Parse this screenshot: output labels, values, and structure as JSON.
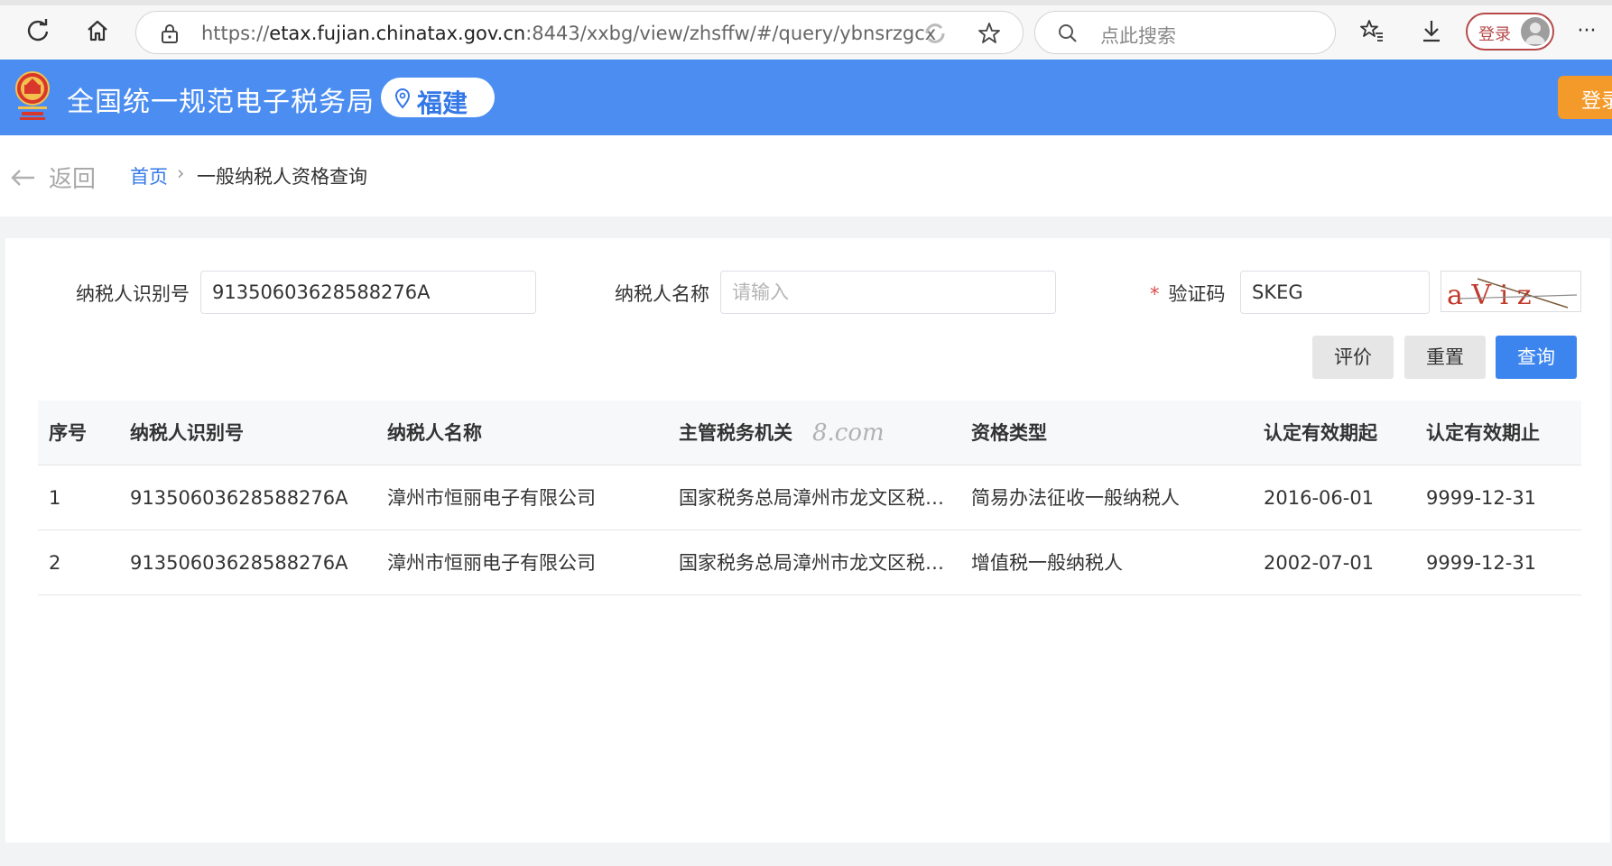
{
  "browser": {
    "url_prefix": "https://",
    "url_host": "etax.fujian.chinatax.gov.cn",
    "url_rest": ":8443/xxbg/view/zhsffw/#/query/ybnsrzgcx",
    "search_placeholder": "点此搜索",
    "login_label": "登录",
    "more_label": "···"
  },
  "header": {
    "site_title": "全国统一规范电子税务局",
    "region": "福建",
    "login_label": "登录"
  },
  "breadcrumb": {
    "back_label": "返回",
    "home": "首页",
    "separator": "›",
    "current": "一般纳税人资格查询"
  },
  "form": {
    "taxpayer_id_label": "纳税人识别号",
    "taxpayer_id_value": "91350603628588276A",
    "taxpayer_name_label": "纳税人名称",
    "taxpayer_name_placeholder": "请输入",
    "captcha_required_mark": "*",
    "captcha_label": "验证码",
    "captcha_value": "SKEG",
    "captcha_image_text": "a V i z",
    "evaluate_label": "评价",
    "reset_label": "重置",
    "query_label": "查询"
  },
  "table": {
    "headers": [
      "序号",
      "纳税人识别号",
      "纳税人名称",
      "主管税务机关",
      "资格类型",
      "认定有效期起",
      "认定有效期止"
    ],
    "watermark": "8.com",
    "rows": [
      [
        "1",
        "91350603628588276A",
        "漳州市恒丽电子有限公司",
        "国家税务总局漳州市龙文区税…",
        "简易办法征收一般纳税人",
        "2016-06-01",
        "9999-12-31"
      ],
      [
        "2",
        "91350603628588276A",
        "漳州市恒丽电子有限公司",
        "国家税务总局漳州市龙文区税…",
        "增值税一般纳税人",
        "2002-07-01",
        "9999-12-31"
      ]
    ]
  },
  "colors": {
    "header_blue": "#4b8df0",
    "link_blue": "#3478e8",
    "query_button": "#3d85ee",
    "login_orange": "#f39a2a",
    "required_red": "#e04b4b"
  }
}
